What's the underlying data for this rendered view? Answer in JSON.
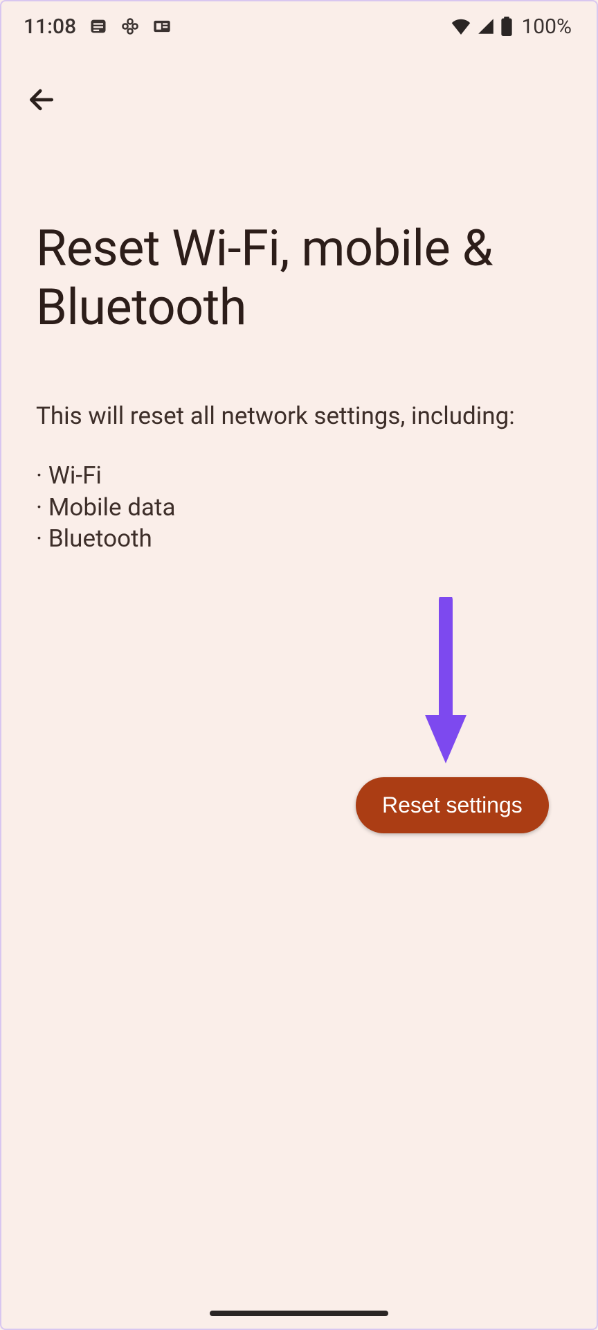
{
  "statusBar": {
    "time": "11:08",
    "batteryPercent": "100%"
  },
  "page": {
    "title": "Reset Wi-Fi, mobile & Bluetooth",
    "description": "This will reset all network settings, including:",
    "bullets": [
      "Wi-Fi",
      "Mobile data",
      "Bluetooth"
    ]
  },
  "actions": {
    "resetLabel": "Reset settings"
  }
}
